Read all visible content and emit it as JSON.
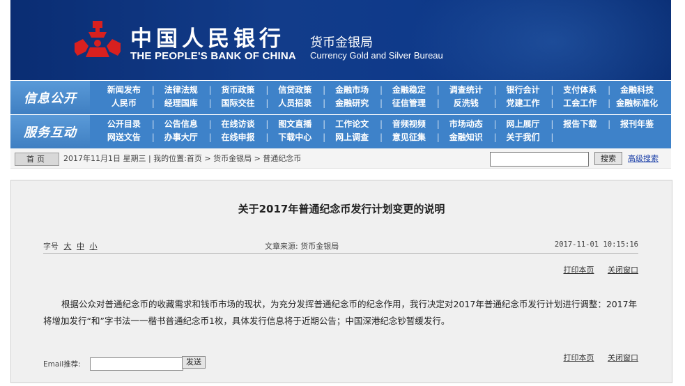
{
  "banner": {
    "bank_cn": "中国人民银行",
    "bank_en": "THE PEOPLE'S BANK OF CHINA",
    "bureau_cn": "货币金银局",
    "bureau_en": "Currency Gold and Silver Bureau",
    "logo_color": "#d8201f",
    "bg_color": "#0f3a8a"
  },
  "nav1": {
    "label": "信息公开",
    "items": [
      [
        "新闻发布",
        "人民币"
      ],
      [
        "法律法规",
        "经理国库"
      ],
      [
        "货币政策",
        "国际交往"
      ],
      [
        "信贷政策",
        "人员招录"
      ],
      [
        "金融市场",
        "金融研究"
      ],
      [
        "金融稳定",
        "征信管理"
      ],
      [
        "调查统计",
        "反洗钱"
      ],
      [
        "银行会计",
        "党建工作"
      ],
      [
        "支付体系",
        "工会工作"
      ],
      [
        "金融科技",
        "金融标准化"
      ]
    ]
  },
  "nav2": {
    "label": "服务互动",
    "items": [
      [
        "公开目录",
        "网送文告"
      ],
      [
        "公告信息",
        "办事大厅"
      ],
      [
        "在线访谈",
        "在线申报"
      ],
      [
        "图文直播",
        "下载中心"
      ],
      [
        "工作论文",
        "网上调查"
      ],
      [
        "音频视频",
        "意见征集"
      ],
      [
        "市场动态",
        "金融知识"
      ],
      [
        "网上展厅",
        "关于我们"
      ],
      [
        "报告下载",
        ""
      ],
      [
        "报刊年鉴",
        ""
      ]
    ]
  },
  "infobar": {
    "home": "首页",
    "date_and_path": "2017年11月1日 星期三 | 我的位置:首页 > 货币金银局 > 普通纪念币",
    "search_placeholder": "",
    "search_button": "搜索",
    "advanced_search": "高级搜索"
  },
  "article": {
    "title": "关于2017年普通纪念币发行计划变更的说明",
    "font_size_label": "字号",
    "font_large": "大",
    "font_medium": "中",
    "font_small": "小",
    "source": "文章来源: 货币金银局",
    "datetime": "2017-11-01  10:15:16",
    "print_page": "打印本页",
    "close_window": "关闭窗口",
    "body": "根据公众对普通纪念币的收藏需求和钱币市场的现状，为充分发挥普通纪念币的纪念作用，我行决定对2017年普通纪念币发行计划进行调整：2017年将增加发行“和”字书法一一楷书普通纪念币1枚，具体发行信息将于近期公告；中国深港纪念钞暂缓发行。",
    "email_label": "Email推荐:",
    "send_button": "发送"
  }
}
